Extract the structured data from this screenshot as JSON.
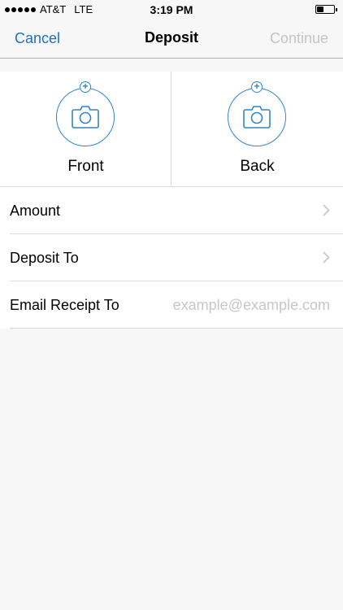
{
  "status_bar": {
    "carrier": "AT&T",
    "network": "LTE",
    "time": "3:19 PM",
    "battery_level": 0.4
  },
  "nav": {
    "cancel_label": "Cancel",
    "title": "Deposit",
    "continue_label": "Continue",
    "accent_color": "#1f6fc5",
    "disabled_color": "#c4c4c4"
  },
  "capture": {
    "front_label": "Front",
    "back_label": "Back",
    "icon": "camera-icon",
    "accent_color": "#2f86c9"
  },
  "form": {
    "amount_label": "Amount",
    "deposit_to_label": "Deposit To",
    "email_label": "Email Receipt To",
    "email_placeholder": "example@example.com",
    "email_value": ""
  }
}
